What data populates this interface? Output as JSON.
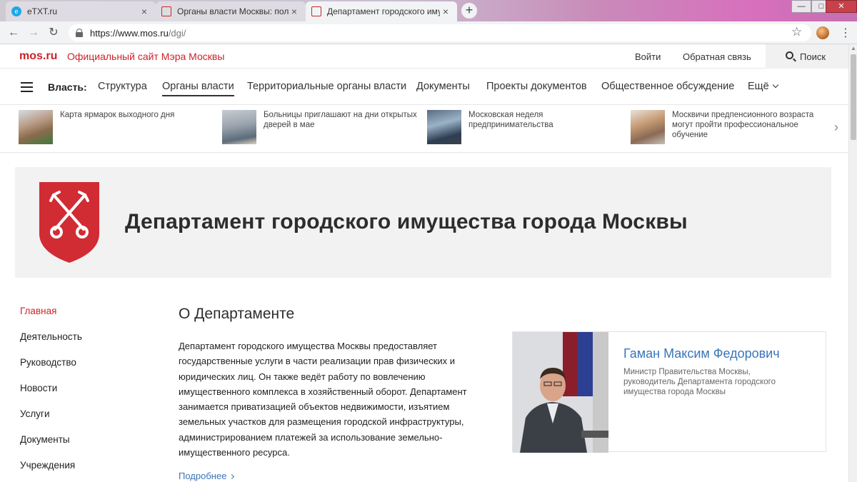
{
  "browser": {
    "tabs": [
      {
        "title": "eTXT.ru",
        "favicon": "etxt-icon",
        "active": false
      },
      {
        "title": "Органы власти Москвы: полный",
        "favicon": "page-icon",
        "active": false
      },
      {
        "title": "Департамент городского имущ",
        "favicon": "page-icon",
        "active": true
      }
    ],
    "new_tab_symbol": "+",
    "tab_close_symbol": "×",
    "url_host": "https://www.mos.ru",
    "url_path": "/dgi/"
  },
  "site": {
    "logo": "mos.ru",
    "site_title": "Официальный сайт Мэра Москвы",
    "login": "Войти",
    "feedback": "Обратная связь",
    "search_label": "Поиск",
    "accent_color": "#cc2229",
    "link_color": "#3a74b8"
  },
  "nav": {
    "label": "Власть:",
    "items": [
      {
        "label": "Структура"
      },
      {
        "label": "Органы власти"
      },
      {
        "label": "Территориальные органы власти"
      },
      {
        "label": "Документы"
      },
      {
        "label": "Проекты документов"
      },
      {
        "label": "Общественное обсуждение"
      },
      {
        "label": "Ещё"
      }
    ],
    "active_index": 1
  },
  "news": [
    {
      "text": "Карта ярмарок выходного дня"
    },
    {
      "text": "Больницы приглашают на дни открытых дверей в мае"
    },
    {
      "text": "Московская неделя предпринимательства"
    },
    {
      "text": "Москвичи предпенсионного возраста могут пройти профессиональное обучение"
    }
  ],
  "banner": {
    "title": "Департамент городского имущества города Москвы",
    "crest_color": "#d12b34"
  },
  "sidebar": {
    "items": [
      {
        "label": "Главная"
      },
      {
        "label": "Деятельность"
      },
      {
        "label": "Руководство"
      },
      {
        "label": "Новости"
      },
      {
        "label": "Услуги"
      },
      {
        "label": "Документы"
      },
      {
        "label": "Учреждения"
      }
    ],
    "active_index": 0
  },
  "about": {
    "title": "О Департаменте",
    "text": "Департамент городского имущества Москвы предоставляет государственные услуги в части реализации прав физических и юридических лиц. Он также ведёт работу по вовлечению имущественного комплекса в хозяйственный оборот. Департамент занимается приватизацией объектов недвижимости, изъятием земельных участков для размещения городской инфраструктуры, администрированием платежей за использование земельно-имущественного ресурса.",
    "more_link": "Подробнее"
  },
  "person": {
    "name": "Гаман Максим Федорович",
    "role": "Министр Правительства Москвы, руководитель Департамента городского имущества города Москвы"
  }
}
